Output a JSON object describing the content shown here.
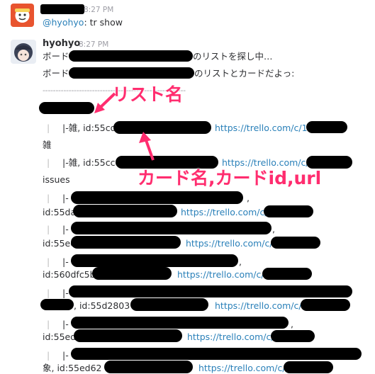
{
  "message1": {
    "time": "8:27 PM",
    "text_mention": "@hyohyo",
    "text_rest": ": tr show"
  },
  "message2": {
    "author": "hyohyo",
    "time": "8:27 PM",
    "line1_prefix": "ボード",
    "line1_suffix": "のリストを探し中…",
    "line2_prefix": "ボード",
    "line2_suffix": "のリストとカードだよっ:",
    "divider": "-------------------------------------------------------",
    "rows": {
      "r1_prefix": "|-雑, id:55cd",
      "r1_link": "https://trello.com/c/1",
      "r1_cont": "雑",
      "r2_prefix": "|-雑, id:55cc8",
      "r2_link": "https://trello.com/c/",
      "r2_cont": "issues",
      "r3_prefix": "|-",
      "r3_comma": ",",
      "r3_id": "id:55da",
      "r3_link": "https://trello.com/c/",
      "r4_prefix": "|-",
      "r4_comma": ",",
      "r4_id": "id:55ec",
      "r4_link": "https://trello.com/c/",
      "r5_prefix": "|-",
      "r5_comma": ",",
      "r5_id": "id:560dfc5b",
      "r5_link": "https://trello.com/c/",
      "r6_prefix": "|-",
      "r6_id": ", id:55d2803",
      "r6_link": "https://trello.com/c/",
      "r7_prefix": "|-",
      "r7_comma": ",",
      "r7_id": "id:55ed0",
      "r7_link": "https://trello.com/c/",
      "r8_prefix": "|-",
      "r8_id": "象, id:55ed62",
      "r8_link": "https://trello.com/c/"
    },
    "pipe": "|"
  },
  "annotations": {
    "list_name": "リスト名",
    "card_info": "カード名,カードid,url"
  },
  "colors": {
    "link": "#2a80b9",
    "annotation": "#ff2d6f",
    "redaction": "#000000"
  }
}
